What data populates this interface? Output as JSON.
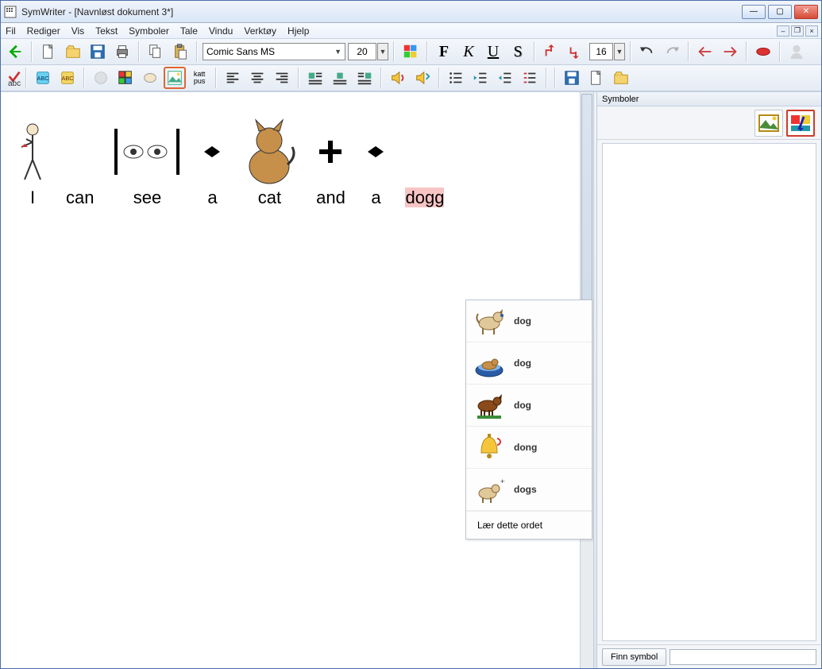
{
  "title": "SymWriter - [Navnløst dokument 3*]",
  "menu": [
    "Fil",
    "Rediger",
    "Vis",
    "Tekst",
    "Symboler",
    "Tale",
    "Vindu",
    "Verktøy",
    "Hjelp"
  ],
  "font": "Comic Sans MS",
  "font_size": "20",
  "section_size": "16",
  "format": {
    "bold": "F",
    "italic": "K",
    "underline": "U",
    "shadow": "S"
  },
  "kattpus": "katt\npus",
  "abc": "abc",
  "sidebar": {
    "title": "Symboler",
    "find_btn": "Finn symbol"
  },
  "words": [
    "I",
    "can",
    "see",
    "a",
    "cat",
    "and",
    "a",
    "dogg"
  ],
  "popup": {
    "items": [
      "dog",
      "dog",
      "dog",
      "dong",
      "dogs"
    ],
    "learn": "Lær dette ordet"
  }
}
